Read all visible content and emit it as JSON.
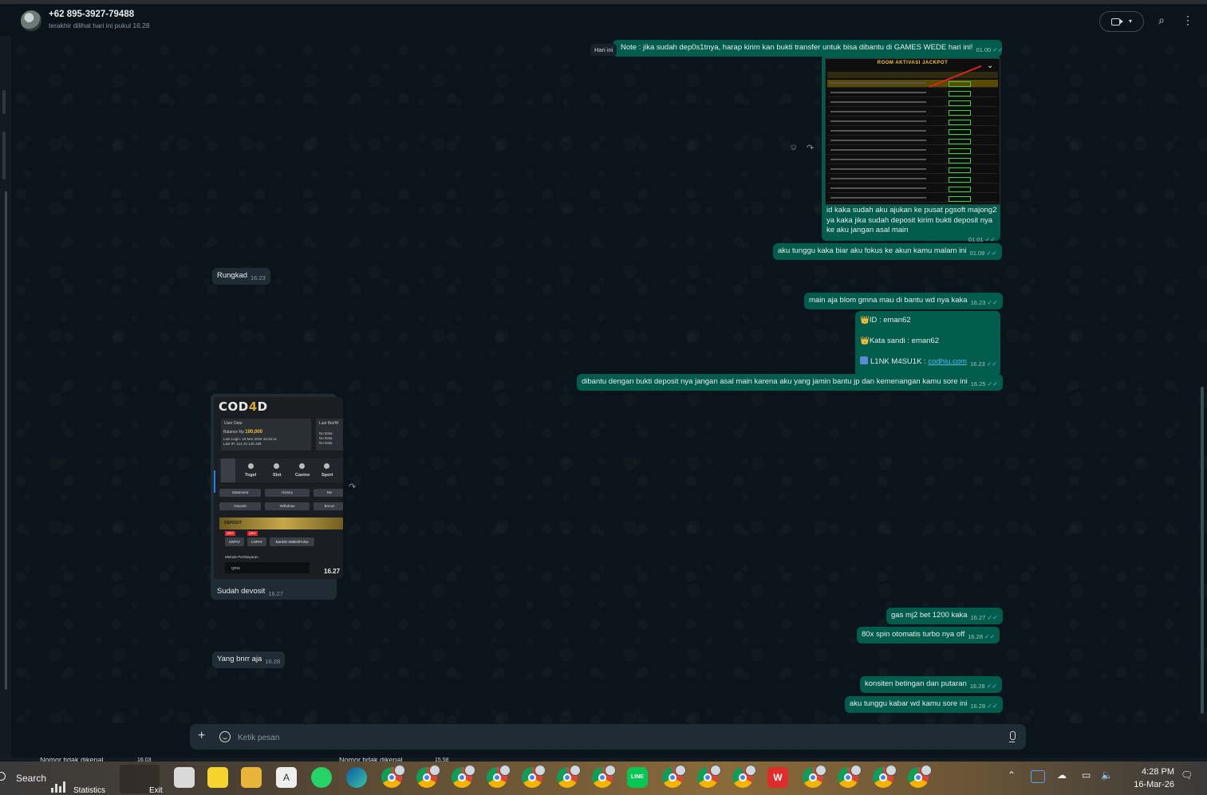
{
  "header": {
    "contact_name": "+62 895-3927-79488",
    "contact_status": "terakhir dilihat hari ini pukul 16.28",
    "icons": [
      "video-call-icon",
      "chevron-down-icon",
      "search-icon",
      "menu-icon"
    ]
  },
  "date_divider": "Hari ini",
  "messages": [
    {
      "dir": "out",
      "text": "Note : jika sudah dep0s1tnya, harap kirim kan bukti transfer untuk bisa dibantu di GAMES WEDE hari ini!",
      "time": "01.00"
    },
    {
      "dir": "out",
      "type": "image",
      "image_title": "ROOM AKTIVASI JACKPOT",
      "caption_lines": [
        "id kaka sudah aku ajukan ke pusat pgsoft majong2",
        "ya kaka jika sudah deposit kirim bukti deposit nya",
        "ke aku jangan asal main"
      ],
      "time": "01.01"
    },
    {
      "dir": "out",
      "text": "aku tunggu kaka biar aku fokus ke akun kamu malam ini",
      "time": "01.09"
    },
    {
      "dir": "in",
      "text": "Rungkad",
      "time": "16.23"
    },
    {
      "dir": "out",
      "text": "main aja blom gmna mau di bantu wd nya kaka",
      "time": "16.23"
    },
    {
      "dir": "out",
      "id_line": "ID :  eman62",
      "pass_line": "Kata sandi : eman62",
      "link_label": "L1NK M4SU1K : ",
      "link": "codhiu.com",
      "time": "16.23"
    },
    {
      "dir": "out",
      "text": "dibantu dengan bukti deposit nya jangan asal main karena aku yang jamin bantu jp dan kemenangan kamu sore ini",
      "time": "16.25"
    },
    {
      "dir": "in",
      "type": "image",
      "time_overlay": "16.27",
      "caption": "Sudah devosit",
      "time": "16.27"
    },
    {
      "dir": "out",
      "text": "gas mj2 bet 1200 kaka",
      "time": "16.27"
    },
    {
      "dir": "out",
      "text": "80x spin otomatis turbo nya off",
      "time": "16.28"
    },
    {
      "dir": "in",
      "text": "Yang bnrr aja",
      "time": "16.28"
    },
    {
      "dir": "out",
      "text": "konsiten betingan dan putaran",
      "time": "16.28"
    },
    {
      "dir": "out",
      "text": "aku tunggu kabar wd kamu sore ini",
      "time": "16.28"
    }
  ],
  "cod4d": {
    "logo_a": "COD",
    "logo_b": "4",
    "logo_c": "D",
    "user_data": "User Data",
    "last_bet": "Last Bet/W",
    "balance_label": "Balance Rp",
    "balance": "100,000",
    "last_login": "Last Login: 16 Mar 2026 16:26:11",
    "last_ip": "Last IP: 114.10.145.185",
    "no_data": "No Data",
    "nav": [
      "Togel",
      "Slot",
      "Casino",
      "Sport"
    ],
    "buttons": [
      "Statement",
      "History",
      "Me",
      "Deposit",
      "Withdraw",
      "Bonus"
    ],
    "deposit_label": "DEPOSIT",
    "pay_options": [
      "HSPAY",
      "LNPAY",
      "Bank/E-Wallet/Pulsa"
    ],
    "pay_badge": "QRIS",
    "method_label": "Metode Pembayaran",
    "method_value": "QRIS"
  },
  "composer": {
    "placeholder": "Ketik pesan"
  },
  "behind_text": {
    "left": "Nomor tidak dikenal",
    "left_time": "16.03",
    "mid": "Nomor tidak dikenal",
    "mid_time": "15.58"
  },
  "taskbar": {
    "search_label": "Search",
    "stats_label": "Statistics",
    "exit_label": "Exit",
    "time": "4:28 PM",
    "date": "16-Mar-26",
    "line_label": "LINE"
  }
}
